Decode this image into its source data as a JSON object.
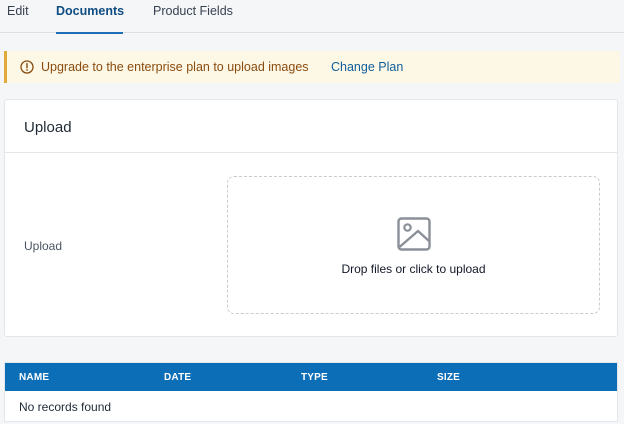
{
  "tabs": [
    {
      "label": "Edit"
    },
    {
      "label": "Documents",
      "active": true
    },
    {
      "label": "Product Fields"
    }
  ],
  "banner": {
    "icon": "info-circle-icon",
    "message": "Upgrade to the enterprise plan to upload images",
    "link": "Change Plan"
  },
  "upload_card": {
    "title": "Upload",
    "field_label": "Upload",
    "dropzone": {
      "icon": "image-icon",
      "text": "Drop files or click to upload"
    }
  },
  "table": {
    "columns": [
      "NAME",
      "DATE",
      "TYPE",
      "SIZE"
    ],
    "empty_message": "No records found"
  },
  "colors": {
    "accent": "#0d6eb8",
    "banner_bg": "#fdf8e6",
    "banner_border": "#e0a93a",
    "banner_text": "#8a4b0f"
  }
}
